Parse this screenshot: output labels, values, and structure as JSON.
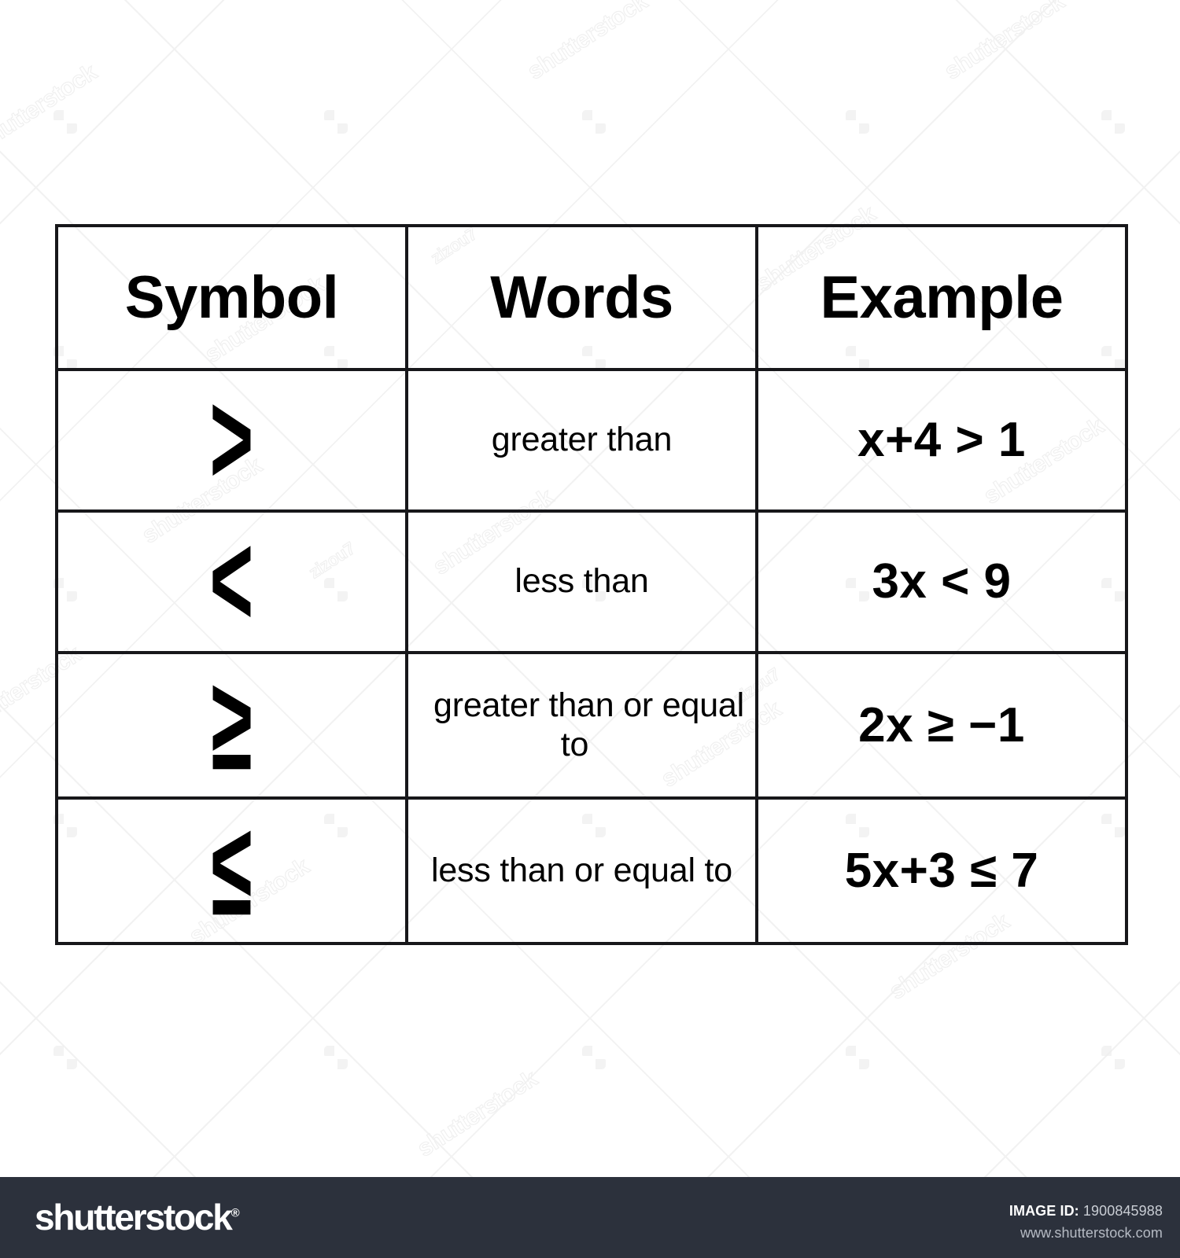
{
  "table": {
    "headers": [
      {
        "label": "Symbol"
      },
      {
        "label": "Words"
      },
      {
        "label": "Example"
      }
    ],
    "rows": [
      {
        "symbol": ">",
        "symbol_name": "greater-than-symbol",
        "words": "greater than",
        "example": "x+4 > 1"
      },
      {
        "symbol": "<",
        "symbol_name": "less-than-symbol",
        "words": "less than",
        "example": "3x < 9"
      },
      {
        "symbol": "≥",
        "symbol_name": "greater-than-or-equal-symbol",
        "words": "greater than or equal to",
        "example": "2x ≥ −1"
      },
      {
        "symbol": "≤",
        "symbol_name": "less-than-or-equal-symbol",
        "words": "less than or equal to",
        "example": "5x+3 ≤ 7"
      }
    ]
  },
  "footer": {
    "brand": "shutterstock",
    "brand_mark": "®",
    "image_id_label": "IMAGE ID:",
    "image_id_value": "1900845988",
    "website": "www.shutterstock.com",
    "background_color": "#2c313c",
    "text_color": "#ffffff"
  },
  "watermark": {
    "word": "shutterstock",
    "contributor": "zizou7",
    "color": "#f0f0f0"
  },
  "style": {
    "page_background": "#ffffff",
    "border_color": "#17171a",
    "text_color": "#000000"
  }
}
